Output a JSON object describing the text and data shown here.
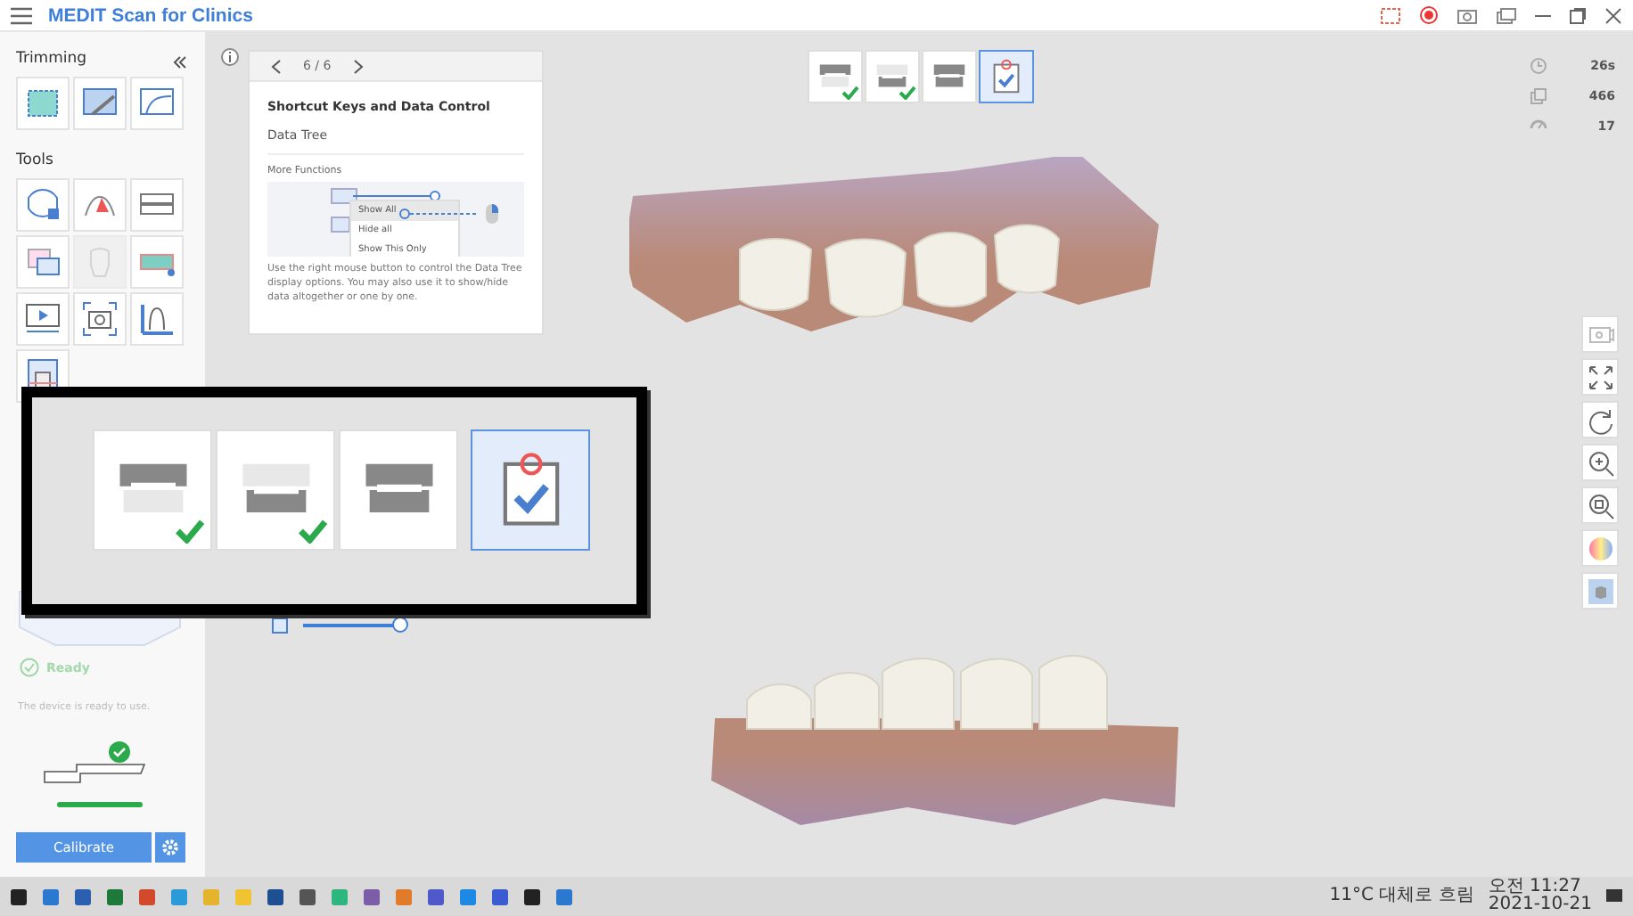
{
  "app": {
    "title": "MEDIT Scan for Clinics"
  },
  "sidebar": {
    "trimming": {
      "title": "Trimming",
      "tools": [
        {
          "kind": "select",
          "disabled": false
        },
        {
          "kind": "brush",
          "disabled": false
        },
        {
          "kind": "curve",
          "disabled": false
        }
      ]
    },
    "tools": {
      "title": "Tools",
      "tools": [
        {
          "kind": "lock",
          "disabled": false
        },
        {
          "kind": "color",
          "disabled": false
        },
        {
          "kind": "arch",
          "disabled": false
        },
        {
          "kind": "layer",
          "disabled": false
        },
        {
          "kind": "tooth",
          "disabled": true
        },
        {
          "kind": "gum",
          "disabled": false
        },
        {
          "kind": "video",
          "disabled": false
        },
        {
          "kind": "camera",
          "disabled": false
        },
        {
          "kind": "ruler",
          "disabled": false
        },
        {
          "kind": "scan",
          "disabled": false
        }
      ]
    },
    "device": {
      "state": "Ready",
      "message": "The device is ready to use.",
      "level": 1
    },
    "calibrate": "Calibrate"
  },
  "tip": {
    "page": "6 / 6",
    "title": "Shortcut Keys and Data Control",
    "subtitle": "Data Tree",
    "section": "More Functions",
    "menu": [
      "Show All",
      "Hide all",
      "Show This Only"
    ],
    "description": "Use the right mouse button to control the Data Tree display options. You may also use it to show/hide data altogether or one by one."
  },
  "stages": [
    {
      "kind": "upper",
      "done": true,
      "selected": false
    },
    {
      "kind": "lower",
      "done": true,
      "selected": false
    },
    {
      "kind": "bite",
      "done": false,
      "selected": false
    },
    {
      "kind": "review",
      "done": false,
      "selected": true
    }
  ],
  "zoom_popup": {
    "stages": [
      {
        "kind": "upper",
        "done": true,
        "selected": false
      },
      {
        "kind": "lower",
        "done": true,
        "selected": false
      },
      {
        "kind": "bite",
        "done": false,
        "selected": false
      },
      {
        "kind": "review",
        "done": false,
        "selected": true
      }
    ]
  },
  "stats": [
    {
      "kind": "time",
      "value": "26s"
    },
    {
      "kind": "copies",
      "value": "466"
    },
    {
      "kind": "speed",
      "value": "17"
    }
  ],
  "opacity_slider": {
    "level": 1
  },
  "view_tools": [
    {
      "kind": "camera"
    },
    {
      "kind": "fit"
    },
    {
      "kind": "rotate"
    },
    {
      "kind": "zoom"
    },
    {
      "kind": "zoomfit"
    },
    {
      "kind": "color"
    },
    {
      "kind": "cube"
    }
  ],
  "taskbar": {
    "weather": "11°C 대체로 흐림",
    "time": "오전 11:27",
    "date": "2021-10-21"
  }
}
